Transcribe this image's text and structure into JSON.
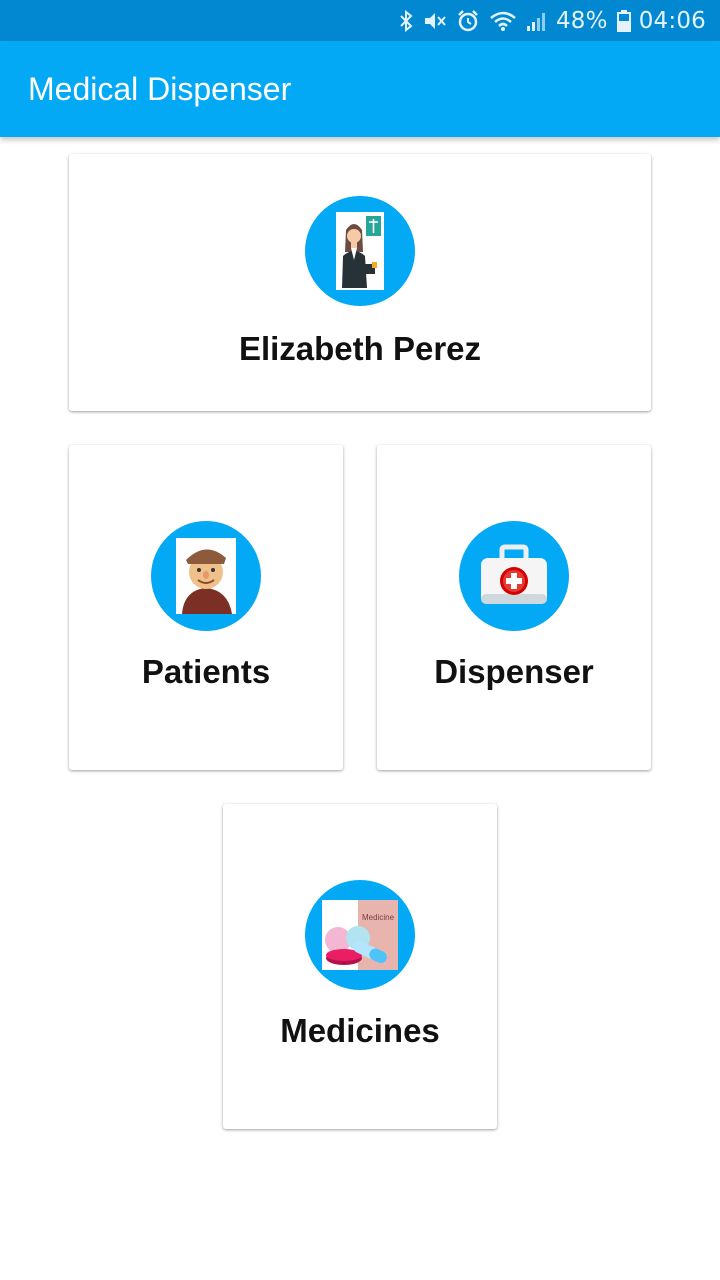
{
  "status_bar": {
    "battery": "48%",
    "time": "04:06",
    "icons": [
      "bluetooth-icon",
      "mute-icon",
      "alarm-icon",
      "wifi-icon",
      "signal-icon",
      "battery-icon"
    ]
  },
  "app_bar": {
    "title": "Medical Dispenser"
  },
  "cards": {
    "profile": {
      "label": "Elizabeth Perez",
      "icon": "doctor-avatar"
    },
    "patients": {
      "label": "Patients",
      "icon": "elderly-patient-image"
    },
    "dispenser": {
      "label": "Dispenser",
      "icon": "first-aid-kit-icon"
    },
    "medicines": {
      "label": "Medicines",
      "icon": "pills-image",
      "image_text": "Medicine"
    }
  },
  "colors": {
    "status_bar": "#0288d1",
    "app_bar": "#03a9f4",
    "icon_circle": "#03a9f4",
    "card": "#ffffff"
  }
}
